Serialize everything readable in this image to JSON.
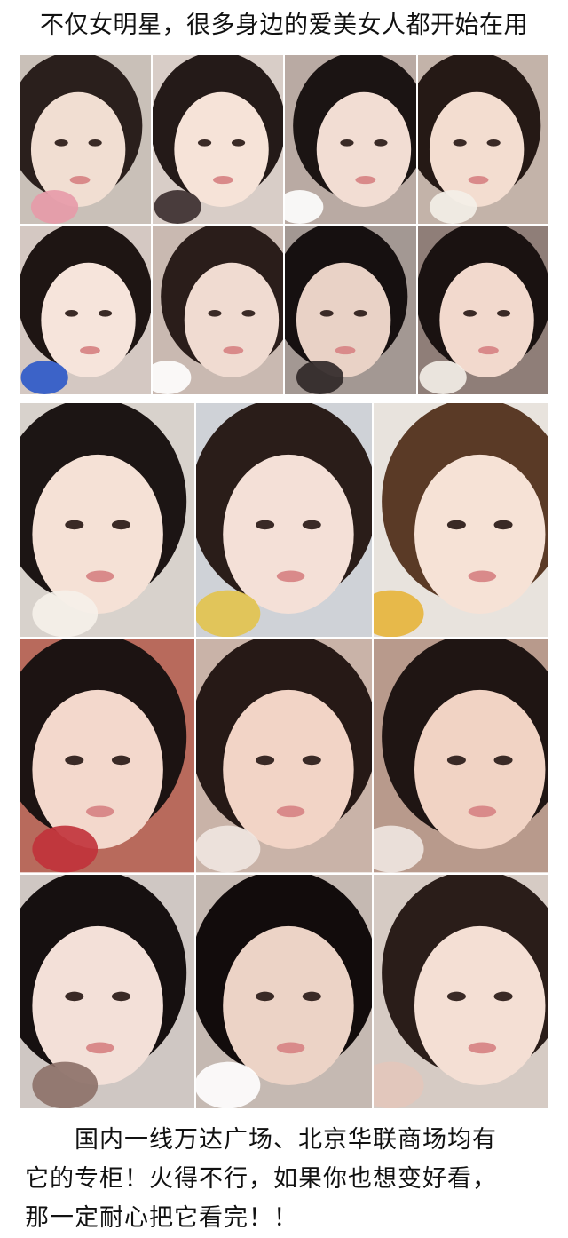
{
  "headline": "不仅女明星，很多身边的爱美女人都开始在用",
  "top_grid": {
    "photos": [
      {
        "label": "selfie-1",
        "bg": "#c9c0b8",
        "skin": "#f1ded2",
        "hair": "#2a1f1c",
        "accent": "#e79aa9"
      },
      {
        "label": "selfie-2",
        "bg": "#d8cdc7",
        "skin": "#f6e3d8",
        "hair": "#241a18",
        "accent": "#3a2c2c"
      },
      {
        "label": "selfie-3",
        "bg": "#b9aaa3",
        "skin": "#f2ddd3",
        "hair": "#1b1413",
        "accent": "#ffffff"
      },
      {
        "label": "selfie-4",
        "bg": "#c3b3a9",
        "skin": "#f3ddd0",
        "hair": "#251915",
        "accent": "#f4efe8"
      },
      {
        "label": "selfie-5",
        "bg": "#d4c8c2",
        "skin": "#f6e4db",
        "hair": "#1e1513",
        "accent": "#2b58c9"
      },
      {
        "label": "selfie-6",
        "bg": "#c9b9b1",
        "skin": "#f0dbd1",
        "hair": "#2a1d1a",
        "accent": "#ffffff"
      },
      {
        "label": "selfie-7",
        "bg": "#a39893",
        "skin": "#e9d2c6",
        "hair": "#161010",
        "accent": "#2e2626"
      },
      {
        "label": "selfie-8",
        "bg": "#8f7e78",
        "skin": "#f2d9cd",
        "hair": "#1a1211",
        "accent": "#f4efe8"
      }
    ]
  },
  "bottom_grid": {
    "photos": [
      {
        "label": "selfie-9",
        "bg": "#d8d2cc",
        "skin": "#f5e1d6",
        "hair": "#1c1514",
        "accent": "#f6f1ea"
      },
      {
        "label": "selfie-10",
        "bg": "#cfd2d7",
        "skin": "#f4e0d7",
        "hair": "#2a1d19",
        "accent": "#e2c34c"
      },
      {
        "label": "selfie-11",
        "bg": "#e8e3dd",
        "skin": "#f6e2d6",
        "hair": "#5a3a26",
        "accent": "#e7b43a"
      },
      {
        "label": "selfie-12",
        "bg": "#b86a5c",
        "skin": "#f3d8cc",
        "hair": "#1c1312",
        "accent": "#c1323a"
      },
      {
        "label": "selfie-13",
        "bg": "#c9b3a8",
        "skin": "#f2d4c6",
        "hair": "#261916",
        "accent": "#f0e6e0"
      },
      {
        "label": "selfie-14",
        "bg": "#b89a8c",
        "skin": "#f1d3c4",
        "hair": "#1f1513",
        "accent": "#efe7e1"
      },
      {
        "label": "selfie-15",
        "bg": "#cfc7c3",
        "skin": "#f3e0d8",
        "hair": "#161010",
        "accent": "#8c7068"
      },
      {
        "label": "selfie-16",
        "bg": "#c5b9b2",
        "skin": "#ecd3c6",
        "hair": "#120c0c",
        "accent": "#ffffff"
      },
      {
        "label": "selfie-17",
        "bg": "#d6cbc4",
        "skin": "#f4dfd4",
        "hair": "#2a1d19",
        "accent": "#e3c7bb"
      }
    ]
  },
  "body_text": {
    "line1": "国内一线万达广场、北京华联商场均有",
    "line2": "它的专柜！火得不行，如果你也想变好看，",
    "line3": "那一定耐心把它看完！！"
  }
}
